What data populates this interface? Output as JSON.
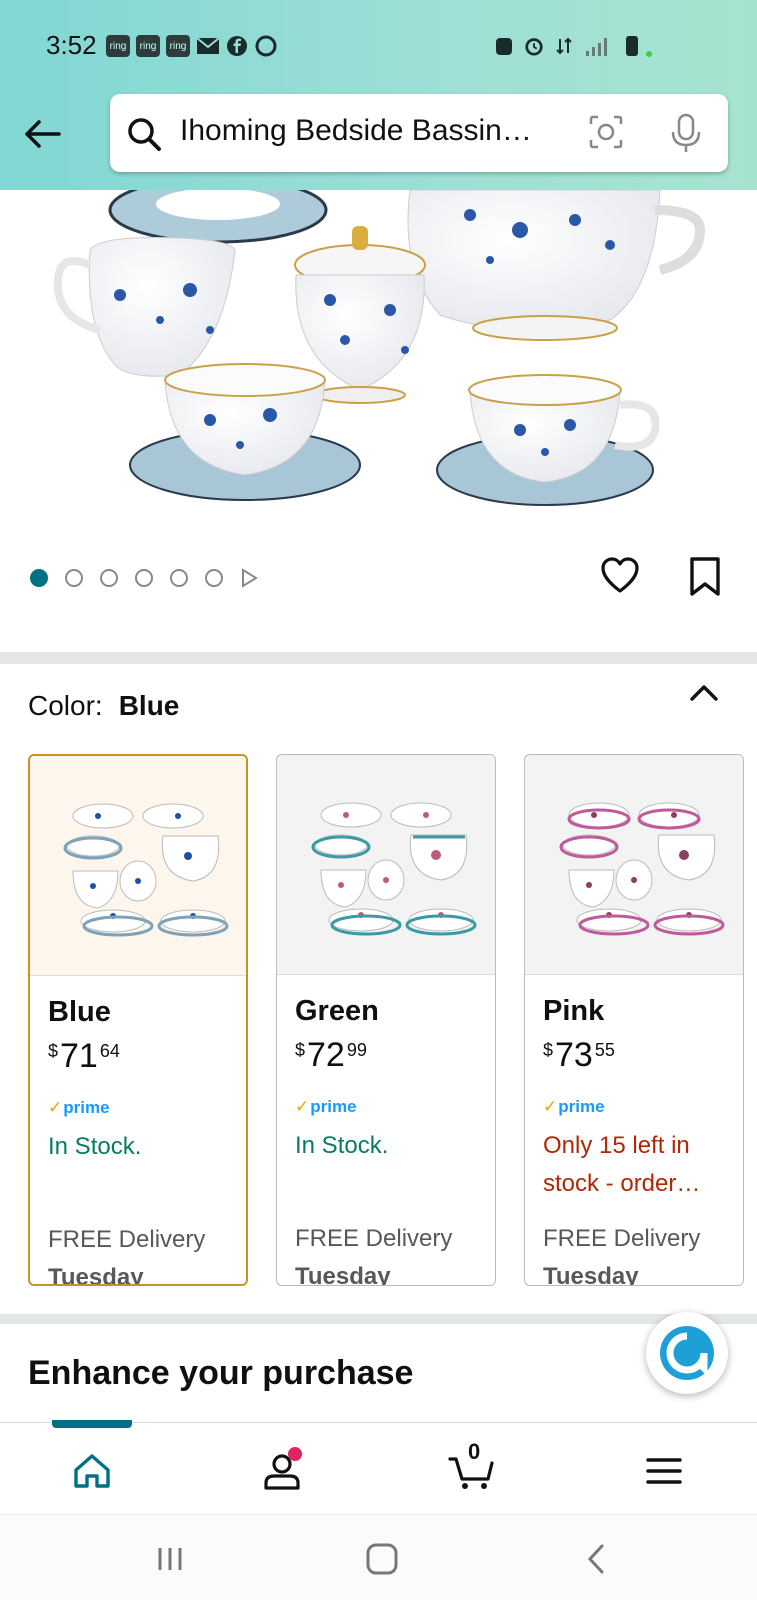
{
  "status_bar": {
    "time": "3:52",
    "left_icons": [
      "ring",
      "ring",
      "ring"
    ],
    "right_icons": [
      "recycle-icon",
      "alarm-icon",
      "data-icon",
      "signal-icon",
      "battery-icon"
    ]
  },
  "search": {
    "query": "Ihoming Bedside Bassin…"
  },
  "product_gallery": {
    "image_description_name": "product-image-tea-set",
    "total_images": 6,
    "active_index": 0
  },
  "color_selector": {
    "label": "Color:",
    "selected": "Blue"
  },
  "swatches": [
    {
      "name": "Blue",
      "currency": "$",
      "price_whole": "71",
      "price_cents": "64",
      "prime": "prime",
      "stock": "In Stock.",
      "delivery": "FREE Delivery",
      "day": "Tuesday",
      "accent": "#1f4fa3"
    },
    {
      "name": "Green",
      "currency": "$",
      "price_whole": "72",
      "price_cents": "99",
      "prime": "prime",
      "stock": "In Stock.",
      "delivery": "FREE Delivery",
      "day": "Tuesday",
      "accent": "#3a9aa6"
    },
    {
      "name": "Pink",
      "currency": "$",
      "price_whole": "73",
      "price_cents": "55",
      "prime": "prime",
      "stock": "Only 15 left in stock - order…",
      "delivery": "FREE Delivery",
      "day": "Tuesday",
      "accent": "#c05a9a"
    }
  ],
  "section": {
    "enhance_title": "Enhance your purchase"
  },
  "bottom_nav": {
    "cart_count": "0",
    "items": [
      "home-icon",
      "account-icon",
      "cart-icon",
      "menu-icon"
    ]
  },
  "colors": {
    "header": "#8fdcd4",
    "teal": "#007185",
    "prime_blue": "#1a98ff",
    "in_stock": "#067d62",
    "low_stock": "#b12704",
    "selected_border": "#c7922a"
  }
}
